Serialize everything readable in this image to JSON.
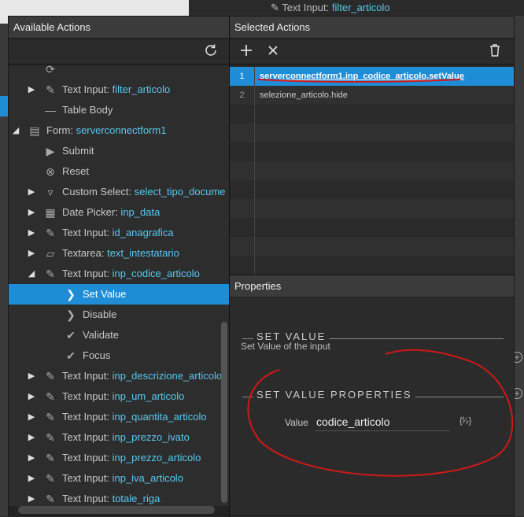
{
  "background": {
    "hint_prefix": "Text Input: ",
    "hint_value": "filter_articolo"
  },
  "left_panel": {
    "title": "Available Actions",
    "refresh_icon": "refresh-icon",
    "tree": [
      {
        "prefix": "",
        "label": "Update",
        "value": "",
        "indent": 1,
        "arrow": "",
        "icon": "update-icon"
      },
      {
        "prefix": "Text Input: ",
        "value": "filter_articolo",
        "indent": 1,
        "arrow": "▶",
        "icon": "pencil-icon"
      },
      {
        "prefix": "Table Body",
        "value": "",
        "indent": 1,
        "arrow": "",
        "icon": "dash-icon"
      },
      {
        "prefix": "Form: ",
        "value": "serverconnectform1",
        "indent": 0,
        "arrow": "◢",
        "icon": "form-icon"
      },
      {
        "prefix": "Submit",
        "value": "",
        "indent": 1,
        "arrow": "",
        "icon": "play-icon"
      },
      {
        "prefix": "Reset",
        "value": "",
        "indent": 1,
        "arrow": "",
        "icon": "reset-icon"
      },
      {
        "prefix": "Custom Select: ",
        "value": "select_tipo_docume",
        "indent": 1,
        "arrow": "▶",
        "icon": "select-icon"
      },
      {
        "prefix": "Date Picker: ",
        "value": "inp_data",
        "indent": 1,
        "arrow": "▶",
        "icon": "calendar-icon"
      },
      {
        "prefix": "Text Input: ",
        "value": "id_anagrafica",
        "indent": 1,
        "arrow": "▶",
        "icon": "pencil-icon"
      },
      {
        "prefix": "Textarea: ",
        "value": "text_intestatario",
        "indent": 1,
        "arrow": "▶",
        "icon": "textarea-icon"
      },
      {
        "prefix": "Text Input: ",
        "value": "inp_codice_articolo",
        "indent": 1,
        "arrow": "◢",
        "icon": "pencil-icon"
      },
      {
        "prefix": "Set Value",
        "value": "",
        "indent": 2,
        "arrow": "",
        "icon": "chevron-right-icon",
        "selected": true
      },
      {
        "prefix": "Disable",
        "value": "",
        "indent": 2,
        "arrow": "",
        "icon": "chevron-right-icon"
      },
      {
        "prefix": "Validate",
        "value": "",
        "indent": 2,
        "arrow": "",
        "icon": "check-icon"
      },
      {
        "prefix": "Focus",
        "value": "",
        "indent": 2,
        "arrow": "",
        "icon": "check-icon"
      },
      {
        "prefix": "Text Input: ",
        "value": "inp_descrizione_articolo",
        "indent": 1,
        "arrow": "▶",
        "icon": "pencil-icon"
      },
      {
        "prefix": "Text Input: ",
        "value": "inp_um_articolo",
        "indent": 1,
        "arrow": "▶",
        "icon": "pencil-icon"
      },
      {
        "prefix": "Text Input: ",
        "value": "inp_quantita_articolo",
        "indent": 1,
        "arrow": "▶",
        "icon": "pencil-icon"
      },
      {
        "prefix": "Text Input: ",
        "value": "inp_prezzo_ivato",
        "indent": 1,
        "arrow": "▶",
        "icon": "pencil-icon"
      },
      {
        "prefix": "Text Input: ",
        "value": "inp_prezzo_articolo",
        "indent": 1,
        "arrow": "▶",
        "icon": "pencil-icon"
      },
      {
        "prefix": "Text Input: ",
        "value": "inp_iva_articolo",
        "indent": 1,
        "arrow": "▶",
        "icon": "pencil-icon"
      },
      {
        "prefix": "Text Input: ",
        "value": "totale_riga",
        "indent": 1,
        "arrow": "▶",
        "icon": "pencil-icon"
      }
    ]
  },
  "right_panel": {
    "title": "Selected Actions",
    "add_icon": "plus-icon",
    "remove_icon": "close-icon",
    "delete_icon": "trash-icon",
    "actions": [
      {
        "num": "1",
        "text": "serverconnectform1.inp_codice_articolo.setValue",
        "selected": true
      },
      {
        "num": "2",
        "text": "selezione_articolo.hide",
        "selected": false
      }
    ]
  },
  "properties": {
    "title": "Properties",
    "section1": "SET VALUE",
    "description": "Set Value of the input",
    "section2": "SET VALUE PROPERTIES",
    "value_label": "Value",
    "value": "codice_articolo",
    "expr_button": "{ᶠ⁄ₓ}"
  },
  "colors": {
    "accent": "#1f8dd6",
    "link": "#58c8f0",
    "annotation": "#d01818"
  }
}
